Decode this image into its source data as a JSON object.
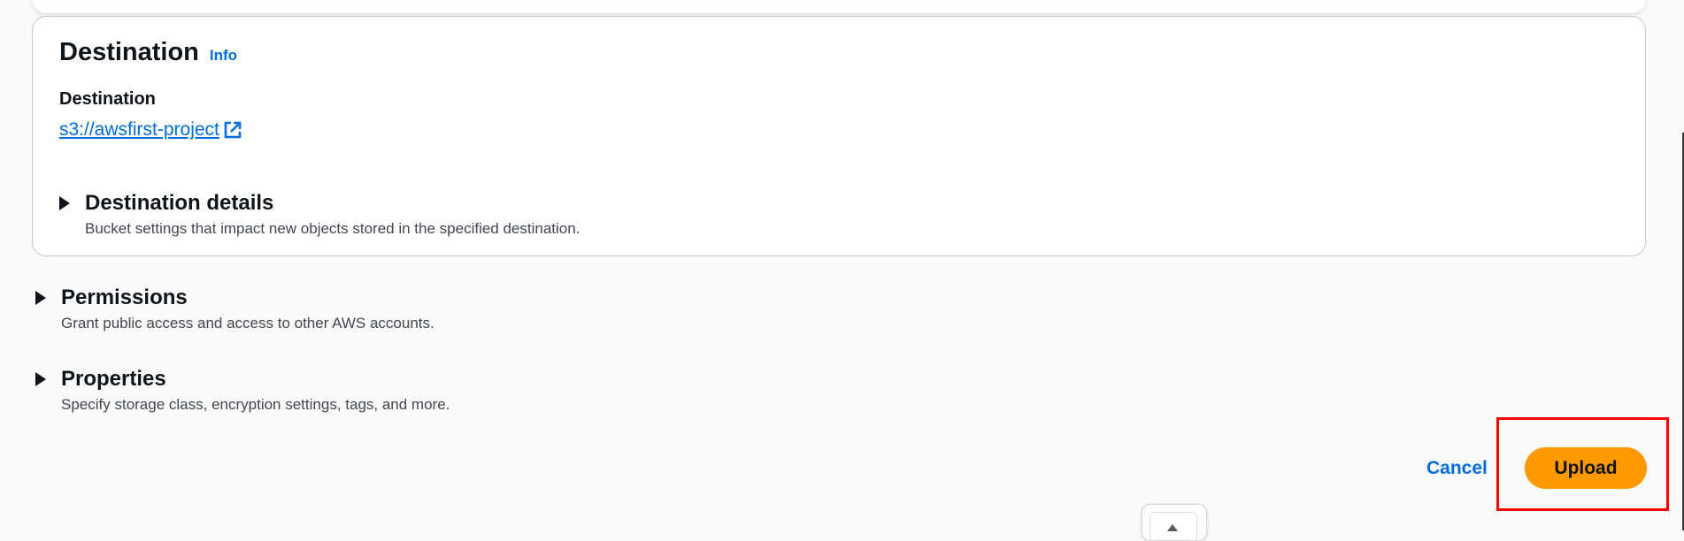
{
  "destination_card": {
    "title": "Destination",
    "info_label": "Info",
    "destination_label": "Destination",
    "destination_link": "s3://awsfirst-project",
    "details": {
      "title": "Destination details",
      "description": "Bucket settings that impact new objects stored in the specified destination."
    }
  },
  "permissions": {
    "title": "Permissions",
    "description": "Grant public access and access to other AWS accounts."
  },
  "properties": {
    "title": "Properties",
    "description": "Specify storage class, encryption settings, tags, and more."
  },
  "actions": {
    "cancel_label": "Cancel",
    "upload_label": "Upload"
  },
  "colors": {
    "link": "#006ce0",
    "primary_button": "#ff9900",
    "highlight": "#ff0000"
  },
  "icons": {
    "external_link": "external-link-icon",
    "caret": "caret-right-icon"
  }
}
